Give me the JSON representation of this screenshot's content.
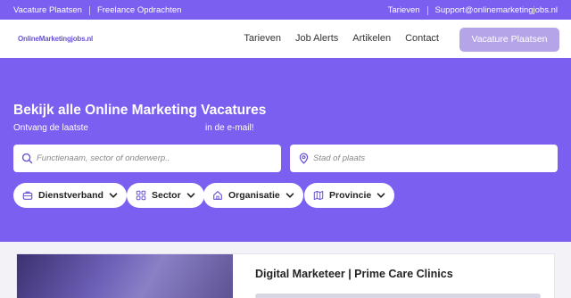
{
  "topbar": {
    "left_links": [
      "Vacature Plaatsen",
      "Freelance Opdrachten"
    ],
    "right_links": [
      "Tarieven",
      "Support@onlinemarketingjobs.nl"
    ]
  },
  "navbar": {
    "logo_text": "OnlineMarketingjobs.nl",
    "nav_items": [
      "Tarieven",
      "Job Alerts",
      "Artikelen",
      "Contact"
    ],
    "cta_label": "Vacature Plaatsen"
  },
  "hero": {
    "title": "Bekijk alle Online Marketing Vacatures",
    "subtitle_part1": "Ontvang de laatste",
    "subtitle_part2": "in de e-mail!",
    "search_placeholder": "Functienaam, sector of onderwerp..",
    "location_placeholder": "Stad of plaats",
    "filters": [
      {
        "label": "Dienstverband",
        "icon": "briefcase-icon"
      },
      {
        "label": "Sector",
        "icon": "grid-icon"
      },
      {
        "label": "Organisatie",
        "icon": "home-icon"
      },
      {
        "label": "Provincie",
        "icon": "map-icon"
      }
    ]
  },
  "job_card": {
    "title": "Digital Marketeer | Prime Care Clinics"
  },
  "colors": {
    "brand": "#7a5ff0",
    "cta": "#b6a4e8"
  }
}
